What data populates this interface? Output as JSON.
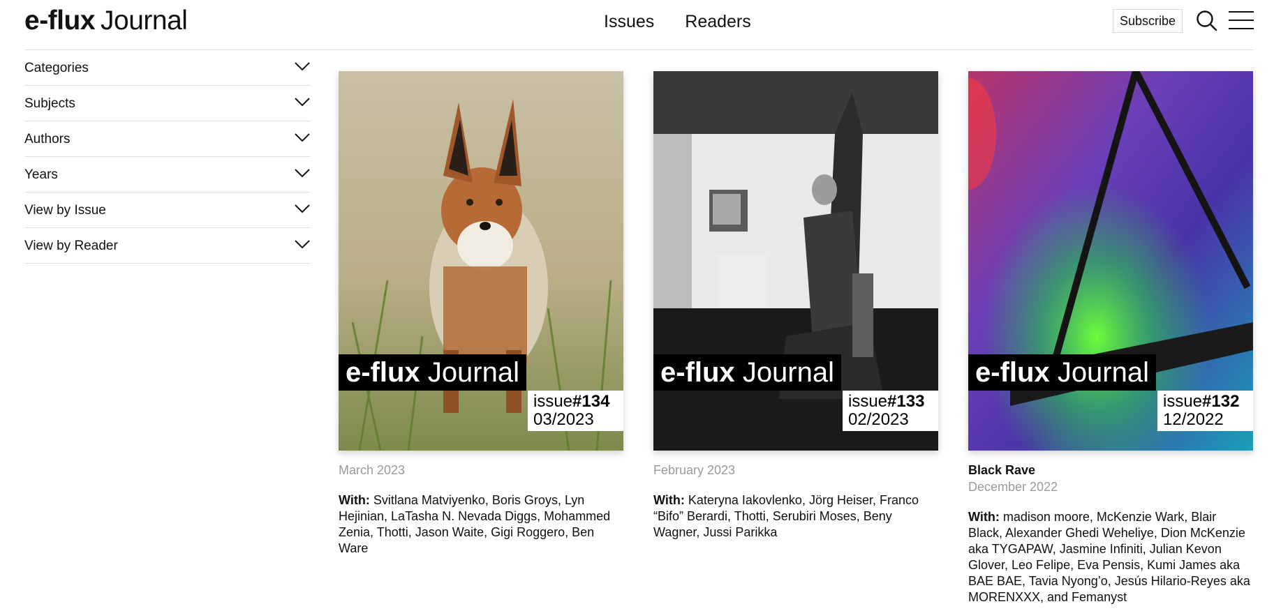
{
  "header": {
    "logo_bold": "e-flux",
    "logo_rest": "Journal",
    "nav": [
      "Issues",
      "Readers"
    ],
    "subscribe_label": "Subscribe",
    "search_icon": "search-icon",
    "menu_icon": "hamburger-menu-icon"
  },
  "sidebar": {
    "filters": [
      "Categories",
      "Subjects",
      "Authors",
      "Years",
      "View by Issue",
      "View by Reader"
    ],
    "chevron_icon": "chevron-down-icon"
  },
  "issues": [
    {
      "cover_brand_bold": "e-flux",
      "cover_brand_rest": "Journal",
      "issue_prefix": "issue",
      "issue_number": "#134",
      "issue_date": "03/2023",
      "title": "",
      "date": "March 2023",
      "with_label": "With:",
      "contributors": "Svitlana Matviyenko, Boris Groys, Lyn Hejinian, LaTasha N. Nevada Diggs, Mohammed Zenia, Thotti, Jason Waite, Gigi Roggero, Ben Ware"
    },
    {
      "cover_brand_bold": "e-flux",
      "cover_brand_rest": "Journal",
      "issue_prefix": "issue",
      "issue_number": "#133",
      "issue_date": "02/2023",
      "title": "",
      "date": "February 2023",
      "with_label": "With:",
      "contributors": "Kateryna Iakovlenko, Jörg Heiser, Franco “Bifo” Berardi, Thotti, Serubiri Moses, Beny Wagner, Jussi Parikka"
    },
    {
      "cover_brand_bold": "e-flux",
      "cover_brand_rest": "Journal",
      "issue_prefix": "issue",
      "issue_number": "#132",
      "issue_date": "12/2022",
      "title": "Black Rave",
      "date": "December 2022",
      "with_label": "With:",
      "contributors": "madison moore, McKenzie Wark, Blair Black, Alexander Ghedi Weheliye, Dion McKenzie aka TYGAPAW, Jasmine Infiniti, Julian Kevon Glover, Leo Felipe, Eva Pensis, Kumi James aka BAE BAE, Tavia Nyong’o, Jesús Hilario-Reyes aka MORENXXX, and Femanyst"
    }
  ]
}
